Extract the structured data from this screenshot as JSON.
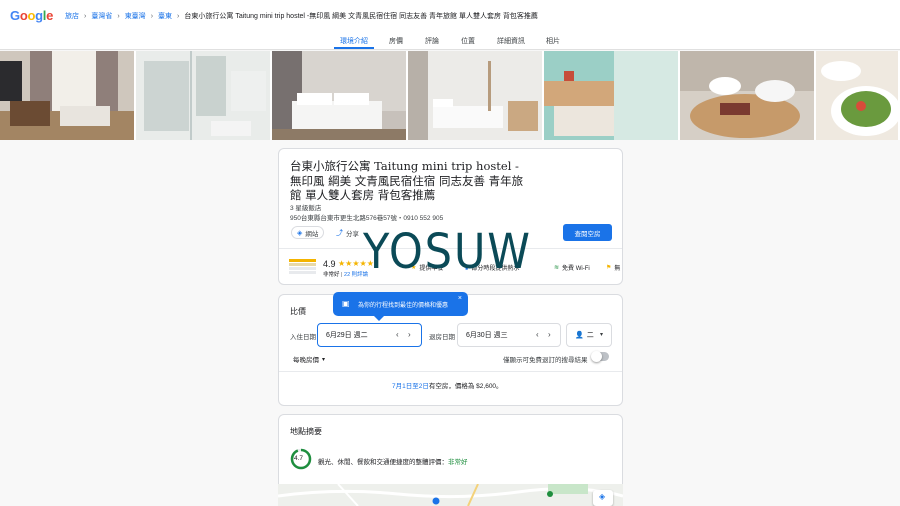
{
  "logo": {
    "letters": [
      "G",
      "o",
      "o",
      "g",
      "l",
      "e"
    ],
    "colors": [
      "#4285f4",
      "#ea4335",
      "#fbbc05",
      "#4285f4",
      "#34a853",
      "#ea4335"
    ]
  },
  "breadcrumb": {
    "items": [
      "旅店",
      "臺灣省",
      "東臺灣",
      "臺東"
    ],
    "current": "台東小旅行公寓 Taitung mini trip hostel -無印風 綱美 文青風民宿住宿 同志友善 青年旅館 單人雙人套房 背包客推薦"
  },
  "tabs": [
    "環境介紹",
    "房價",
    "評論",
    "位置",
    "詳細資訊",
    "相片"
  ],
  "hotel": {
    "title": "台東小旅行公寓 Taitung mini trip hostel -無印風 綱美 文青風民宿住宿 同志友善 青年旅館 單人雙人套房 背包客推薦",
    "class": "3 星級飯店",
    "address": "950台東縣台東市更生北路576巷57號・0910 552 905",
    "website_label": "網站",
    "share_label": "分享",
    "check_rooms_label": "查閱空房",
    "rating": "4.9",
    "rating_text": "非常好",
    "review_count": "22 則評論",
    "amenity_1": "提供早餐",
    "amenity_2": "部分時段提供熱水",
    "amenity_3": "免費 Wi-Fi",
    "amenity_4": "無"
  },
  "pricing": {
    "heading": "比價",
    "checkin_label": "入住日期",
    "checkin_value": "6月29日 週二",
    "checkout_label": "退房日期",
    "checkout_value": "6月30日 週三",
    "guests_value": "二",
    "nightly_label": "每晚房價",
    "free_cancel_label": "僅顯示可免費退訂的搜尋結果",
    "availability_link": "7月1日至2日",
    "availability_rest": "有空房，價格為 $2,600。"
  },
  "tooltip": {
    "text": "為你的行程找到最佳的價格和優惠"
  },
  "location": {
    "heading": "地點摘要",
    "score": "4.7",
    "desc_prefix": "觀光、休閒、餐飲和交通便捷度的整體評價：",
    "desc_rating": "非常好"
  },
  "watermark": "YOSUW",
  "accent_color": "#1a73e8"
}
